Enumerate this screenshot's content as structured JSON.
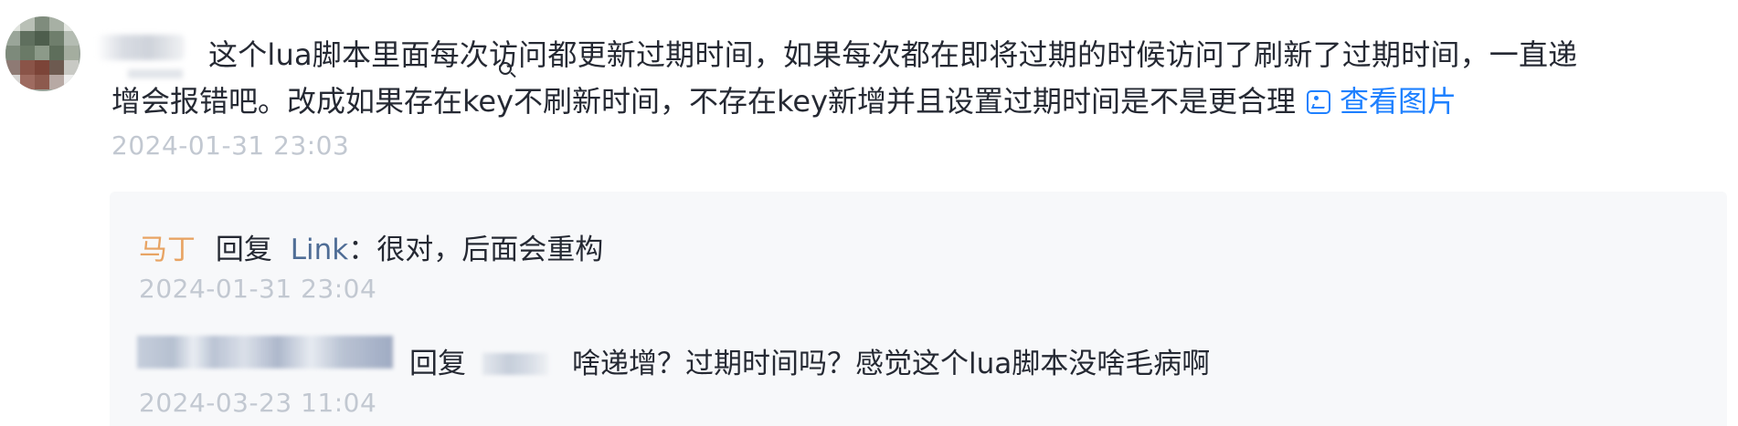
{
  "comment": {
    "text_line1": "这个lua脚本里面每次访问都更新过期时间，如果每次都在即将过期的时候访问了刷新了过期时间，一直递",
    "text_line2": "增会报错吧。改成如果存在key不刷新时间，不存在key新增并且设置过期时间是不是更合理",
    "view_image_label": "查看图片",
    "timestamp": "2024-01-31 23:03"
  },
  "replies": [
    {
      "author": "马丁",
      "reply_word": "回复",
      "target": "Link",
      "separator": "：",
      "text": "很对，后面会重构",
      "timestamp": "2024-01-31 23:04"
    },
    {
      "reply_word": "回复",
      "text": "啥递增？过期时间吗？感觉这个lua脚本没啥毛病啊",
      "timestamp": "2024-03-23 11:04"
    }
  ],
  "colors": {
    "text": "#252933",
    "muted": "#c2c8d1",
    "link": "#1e80ff",
    "author": "#e8a464",
    "reply_target": "#4f6d96",
    "reply_bg": "#f7f8fa"
  },
  "icons": {
    "view_image": "image-icon",
    "cursor": "zoom-cursor-icon"
  }
}
